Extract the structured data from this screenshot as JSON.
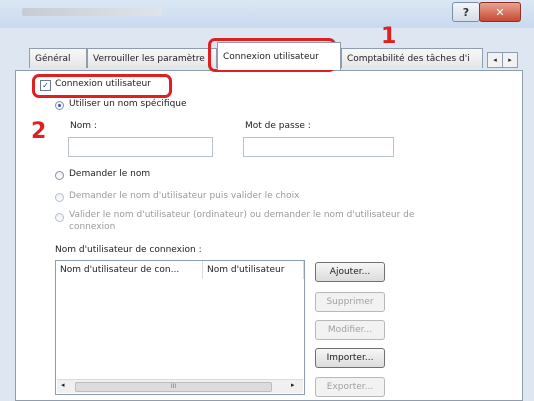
{
  "window": {
    "help_symbol": "?",
    "close_symbol": "✕"
  },
  "tabs": [
    {
      "label": "Général"
    },
    {
      "label": "Verrouiller les paramètre"
    },
    {
      "label": "Connexion utilisateur"
    },
    {
      "label": "Comptabilité des tâches d'i"
    }
  ],
  "tab_scroll": {
    "left": "◂",
    "right": "▸"
  },
  "callouts": {
    "step1": "1",
    "step2": "2"
  },
  "login": {
    "enable_checkbox_label": "Connexion utilisateur",
    "enable_checked_symbol": "✓",
    "option_specific_name": "Utiliser un nom spécifique",
    "name_label": "Nom :",
    "password_label": "Mot de passe :",
    "option_ask_name": "Demander le nom",
    "option_ask_name_validate": "Demander le nom d'utilisateur puis valider le choix",
    "option_validate_line1": "Valider le nom d'utilisateur (ordinateur) ou demander le nom d'utilisateur de",
    "option_validate_line2": "connexion"
  },
  "list": {
    "title": "Nom d'utilisateur de connexion :",
    "columns": [
      "Nom d'utilisateur de con...",
      "Nom d'utilisateur"
    ],
    "scroll_left": "◂",
    "scroll_right": "▸",
    "scroll_thumb": "III"
  },
  "buttons": {
    "add": "Ajouter...",
    "delete": "Supprimer",
    "edit": "Modifier...",
    "import": "Importer...",
    "export": "Exporter..."
  }
}
